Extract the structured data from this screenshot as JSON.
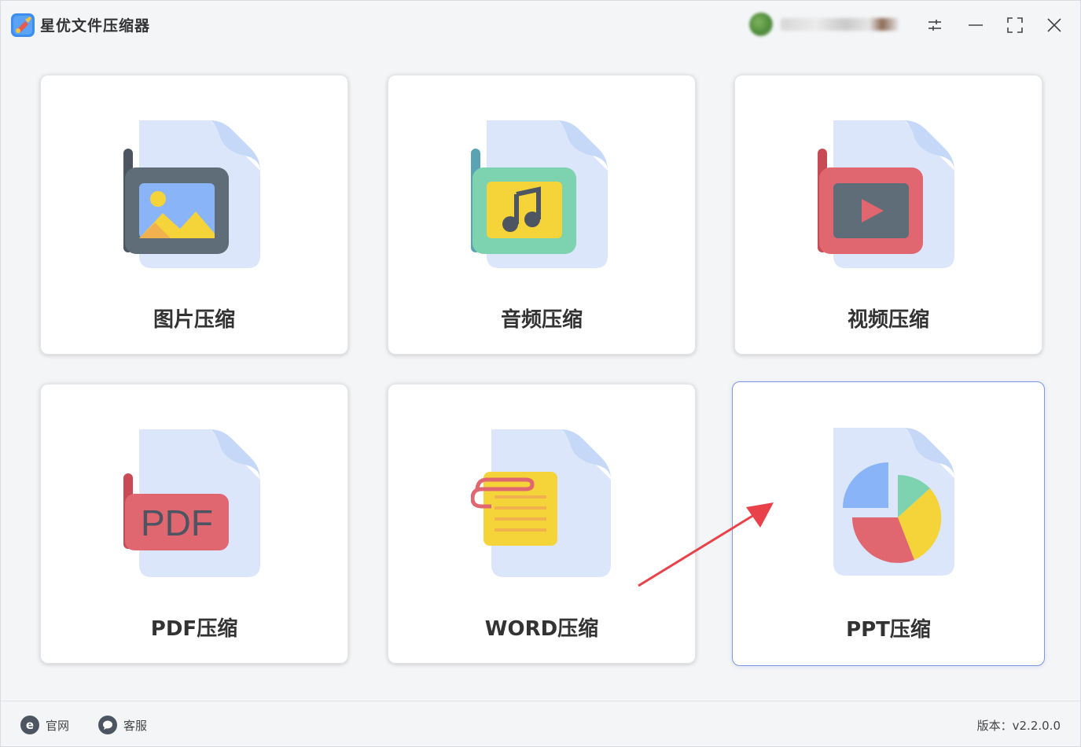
{
  "app": {
    "title": "星优文件压缩器",
    "brand_color": "#2e7be0"
  },
  "window_controls": {
    "settings_icon": "sliders-icon",
    "minimize_icon": "minimize-icon",
    "maximize_icon": "maximize-icon",
    "close_icon": "close-icon"
  },
  "cards": [
    {
      "label": "图片压缩",
      "icon": "image-file-icon"
    },
    {
      "label": "音频压缩",
      "icon": "audio-file-icon"
    },
    {
      "label": "视频压缩",
      "icon": "video-file-icon"
    },
    {
      "label": "PDF压缩",
      "icon": "pdf-file-icon",
      "badge": "PDF"
    },
    {
      "label": "WORD压缩",
      "icon": "word-file-icon"
    },
    {
      "label": "PPT压缩",
      "icon": "ppt-file-icon",
      "selected": true
    }
  ],
  "footer": {
    "website_label": "官网",
    "support_label": "客服",
    "version_text": "版本：v2.2.0.0"
  },
  "colors": {
    "file_back": "#dbe6fb",
    "file_fold": "#c6d8f7",
    "selected_border": "#7c95e6",
    "arrow": "#e8414a"
  }
}
